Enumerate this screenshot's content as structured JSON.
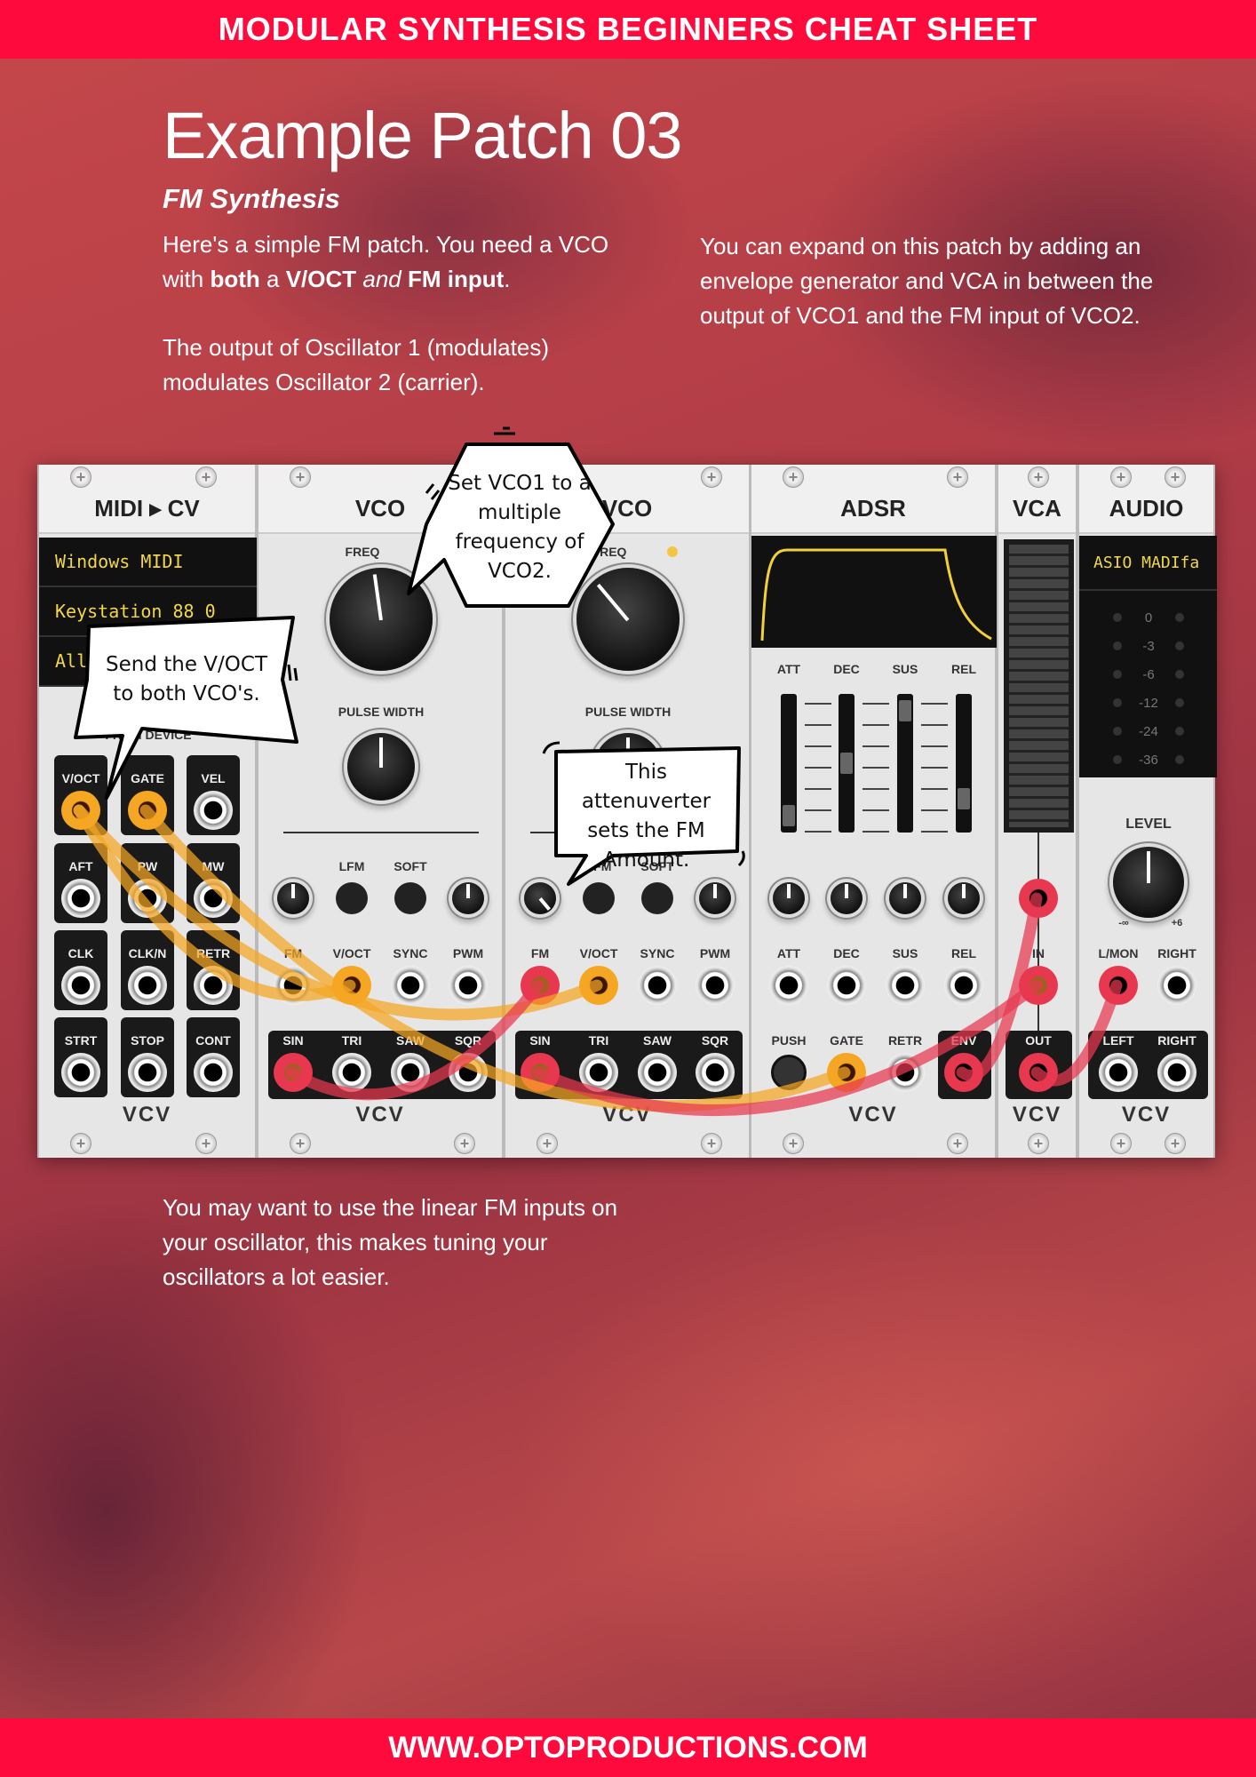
{
  "header": {
    "title": "MODULAR SYNTHESIS BEGINNERS CHEAT SHEET"
  },
  "footer": {
    "url": "WWW.OPTOPRODUCTIONS.COM"
  },
  "page": {
    "title": "Example Patch 03",
    "subtitle": "FM Synthesis",
    "intro": {
      "part1": "Here's a simple FM patch. You need a VCO with ",
      "both": "both",
      "a": " a ",
      "voct": "V/OCT",
      "and": " and ",
      "fm": "FM input",
      "end": "."
    },
    "intro2": "The output of Oscillator 1 (modulates) modulates Oscillator 2 (carrier).",
    "right_text": "You can expand on this patch by adding an envelope generator and VCA in between the output of VCO1 and the FM input of VCO2.",
    "bottom_text": "You may want to use the linear FM inputs on your oscillator, this makes tuning your oscillators a lot easier."
  },
  "colors": {
    "brand": "#ff0a3c",
    "cable_yellow": "#f5a623",
    "cable_red": "#e8384f"
  },
  "rack": {
    "midi_cv": {
      "title": "MIDI ▸ CV",
      "displays": [
        "Windows MIDI",
        "Keystation 88 0",
        "All"
      ],
      "section_label": "FROM DEVICE",
      "jacks": [
        [
          "V/OCT",
          "GATE",
          "VEL"
        ],
        [
          "AFT",
          "PW",
          "MW"
        ],
        [
          "CLK",
          "CLK/N",
          "RETR"
        ],
        [
          "STRT",
          "STOP",
          "CONT"
        ]
      ],
      "logo": "VCV"
    },
    "vco1": {
      "title": "VCO",
      "freq_label": "FREQ",
      "pw_label": "PULSE WIDTH",
      "switch_labels": [
        "LFM",
        "SOFT"
      ],
      "inputs": [
        "FM",
        "V/OCT",
        "SYNC",
        "PWM"
      ],
      "outputs": [
        "SIN",
        "TRI",
        "SAW",
        "SQR"
      ],
      "logo": "VCV"
    },
    "vco2": {
      "title": "VCO",
      "freq_label": "FREQ",
      "pw_label": "PULSE WIDTH",
      "switch_labels": [
        "LFM",
        "SOFT"
      ],
      "inputs": [
        "FM",
        "V/OCT",
        "SYNC",
        "PWM"
      ],
      "outputs": [
        "SIN",
        "TRI",
        "SAW",
        "SQR"
      ],
      "logo": "VCV"
    },
    "adsr": {
      "title": "ADSR",
      "sliders": [
        "ATT",
        "DEC",
        "SUS",
        "REL"
      ],
      "slider_levels": [
        0.05,
        0.5,
        0.95,
        0.2
      ],
      "inputs": [
        "ATT",
        "DEC",
        "SUS",
        "REL"
      ],
      "bottom": [
        "PUSH",
        "GATE",
        "RETR",
        "ENV"
      ],
      "logo": "VCV"
    },
    "vca": {
      "title": "VCA",
      "input": "IN",
      "output": "OUT",
      "logo": "VCV"
    },
    "audio": {
      "title": "AUDIO",
      "device": "ASIO MADIfa",
      "meter_labels": [
        "0",
        "-3",
        "-6",
        "-12",
        "-24",
        "-36"
      ],
      "level_label": "LEVEL",
      "level_min": "-∞",
      "level_max": "+6",
      "inputs": [
        "L/MON",
        "RIGHT"
      ],
      "outputs": [
        "LEFT",
        "RIGHT"
      ],
      "logo": "VCV"
    }
  },
  "callouts": {
    "vco1_freq": "Set VCO1 to a multiple frequency of VCO2.",
    "voct": "Send the V/OCT to both VCO's.",
    "attenuverter": "This attenuverter sets the FM Amount."
  }
}
